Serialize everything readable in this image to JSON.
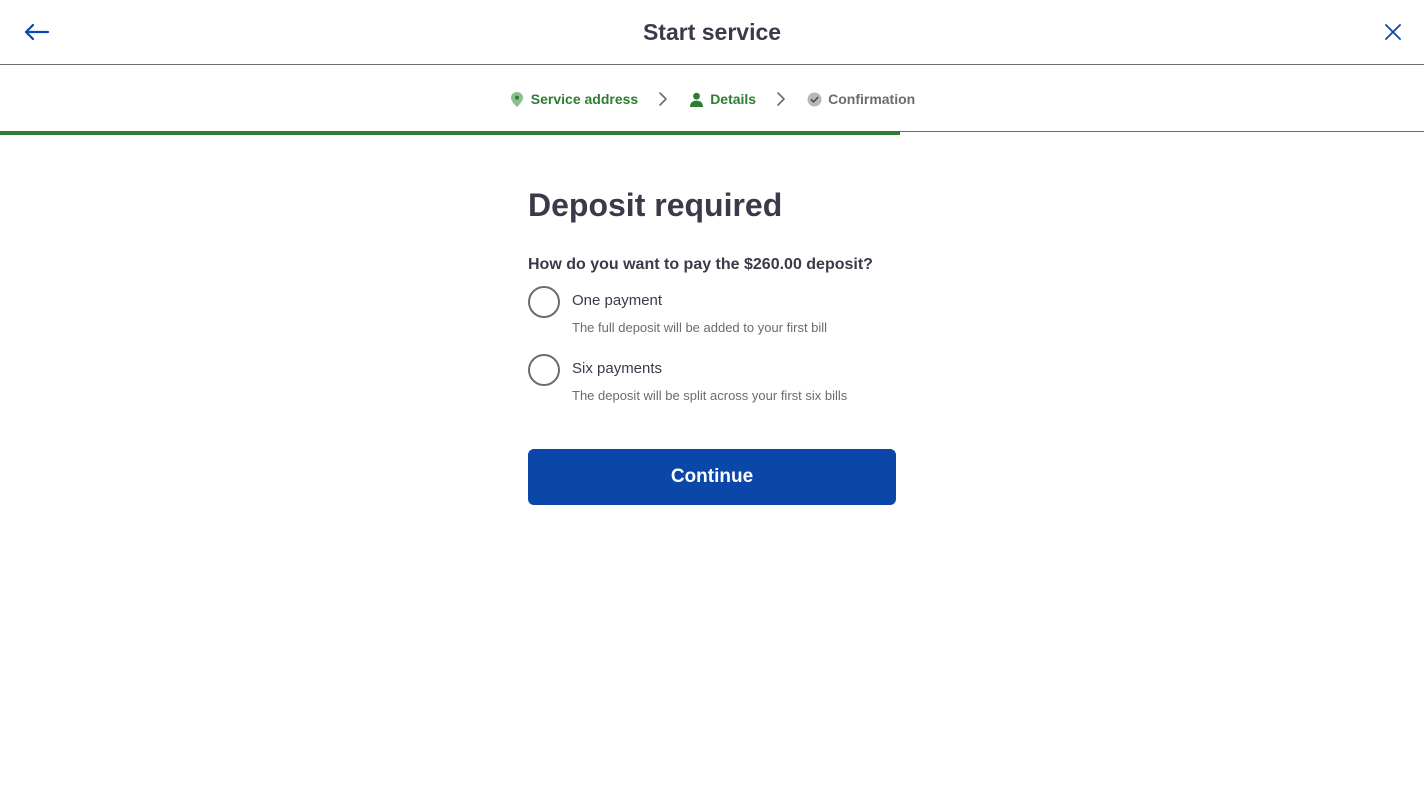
{
  "header": {
    "title": "Start service",
    "back_icon": "arrow-left-icon",
    "close_icon": "close-icon"
  },
  "stepper": {
    "steps": [
      {
        "label": "Service address",
        "icon": "location-pin-icon",
        "state": "done"
      },
      {
        "label": "Details",
        "icon": "person-icon",
        "state": "done"
      },
      {
        "label": "Confirmation",
        "icon": "check-circle-icon",
        "state": "pending"
      }
    ],
    "progress_fraction": 0.632
  },
  "main": {
    "heading": "Deposit required",
    "question": "How do you want to pay the $260.00 deposit?",
    "options": [
      {
        "label": "One payment",
        "description": "The full deposit will be added to your first bill",
        "selected": false
      },
      {
        "label": "Six payments",
        "description": "The deposit will be split across your first six bills",
        "selected": false
      }
    ],
    "continue_label": "Continue"
  },
  "colors": {
    "primary": "#0a47a9",
    "success": "#2e7d32",
    "text": "#3a3a4a",
    "muted": "#6b6b73"
  }
}
